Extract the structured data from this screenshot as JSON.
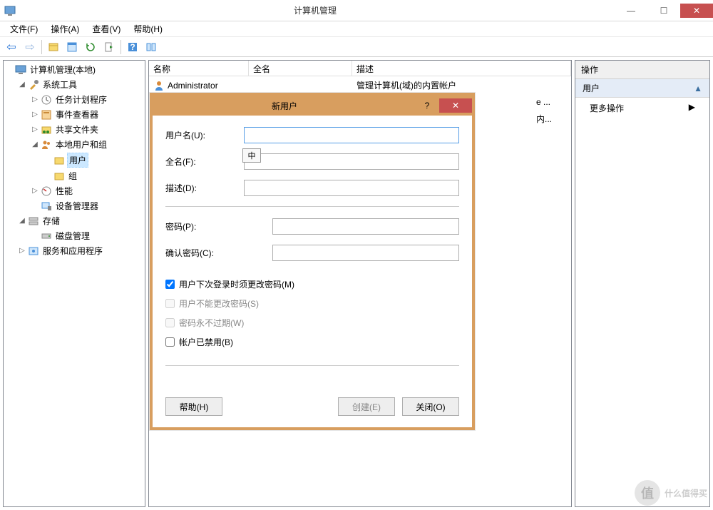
{
  "window": {
    "title": "计算机管理",
    "minimize_glyph": "—",
    "maximize_glyph": "☐",
    "close_glyph": "✕"
  },
  "menubar": {
    "file": "文件(F)",
    "action": "操作(A)",
    "view": "查看(V)",
    "help": "帮助(H)"
  },
  "toolbar_items": [
    "back",
    "forward",
    "sep",
    "up",
    "home",
    "refresh",
    "export",
    "sep",
    "help",
    "show-hide"
  ],
  "tree": {
    "root": "计算机管理(本地)",
    "system_tools": "系统工具",
    "task_scheduler": "任务计划程序",
    "event_viewer": "事件查看器",
    "shared_folders": "共享文件夹",
    "local_users": "本地用户和组",
    "users": "用户",
    "groups": "组",
    "performance": "性能",
    "device_manager": "设备管理器",
    "storage": "存储",
    "disk_management": "磁盘管理",
    "services_apps": "服务和应用程序"
  },
  "list": {
    "headers": {
      "name": "名称",
      "fullname": "全名",
      "description": "描述"
    },
    "rows": [
      {
        "name": "Administrator",
        "fullname": "",
        "description": "管理计算机(域)的内置帐户"
      },
      {
        "name": "",
        "fullname": "",
        "description": "e ..."
      },
      {
        "name": "",
        "fullname": "",
        "description": "内..."
      }
    ]
  },
  "actions": {
    "header": "操作",
    "section": "用户",
    "more": "更多操作",
    "arrow": "▶"
  },
  "dialog": {
    "title": "新用户",
    "help_glyph": "?",
    "close_glyph": "✕",
    "username_label": "用户名(U):",
    "fullname_label": "全名(F):",
    "description_label": "描述(D):",
    "password_label": "密码(P):",
    "confirm_password_label": "确认密码(C):",
    "must_change_label": "用户下次登录时须更改密码(M)",
    "cannot_change_label": "用户不能更改密码(S)",
    "never_expires_label": "密码永不过期(W)",
    "disabled_label": "帐户已禁用(B)",
    "help_btn": "帮助(H)",
    "create_btn": "创建(E)",
    "close_btn": "关闭(O)",
    "ime_badge": "中"
  },
  "watermark": {
    "circle": "值",
    "text": "什么值得买"
  }
}
